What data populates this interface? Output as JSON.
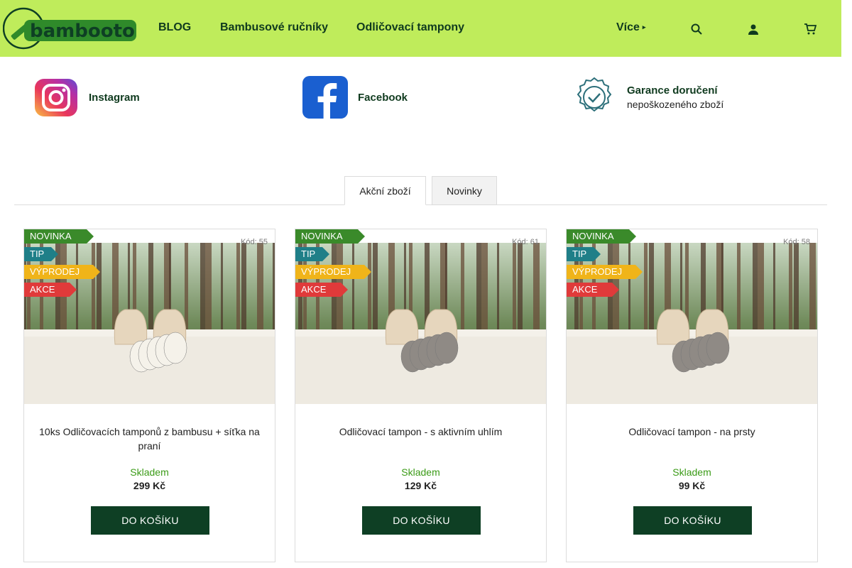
{
  "header": {
    "logo_text": "bambooto",
    "nav": [
      {
        "label": "BLOG"
      },
      {
        "label": "Bambusové ručníky"
      },
      {
        "label": "Odličovací tampony"
      }
    ],
    "more_label": "Více",
    "more_caret": "▸",
    "icons": [
      "search-icon",
      "user-icon",
      "cart-icon"
    ]
  },
  "info": {
    "instagram_label": "Instagram",
    "facebook_label": "Facebook",
    "guarantee_title": "Garance doručení",
    "guarantee_sub": "nepoškozeného zboží"
  },
  "tabs": [
    {
      "label": "Akční zboží",
      "active": true
    },
    {
      "label": "Novinky",
      "active": false
    }
  ],
  "flags": {
    "novinka": "NOVINKA",
    "tip": "TIP",
    "vyprodej": "VÝPRODEJ",
    "akce": "AKCE"
  },
  "colors": {
    "header_bg": "#bfec5b",
    "brand_dark": "#0e3f24",
    "flag_novinka": "#3a8a2a",
    "flag_tip": "#1f7f88",
    "flag_vyprodej": "#f0b419",
    "flag_akce": "#e03a3a",
    "stock_green": "#3b9b17"
  },
  "products": [
    {
      "code": "Kód: 55",
      "name": "10ks Odličovacích tamponů z bambusu + síťka na praní",
      "stock": "Skladem",
      "price": "299 Kč",
      "button": "DO KOŠÍKU"
    },
    {
      "code": "Kód: 61",
      "name": "Odličovací tampon - s aktivním uhlím",
      "stock": "Skladem",
      "price": "129 Kč",
      "button": "DO KOŠÍKU"
    },
    {
      "code": "Kód: 58",
      "name": "Odličovací tampon - na prsty",
      "stock": "Skladem",
      "price": "99 Kč",
      "button": "DO KOŠÍKU"
    }
  ]
}
